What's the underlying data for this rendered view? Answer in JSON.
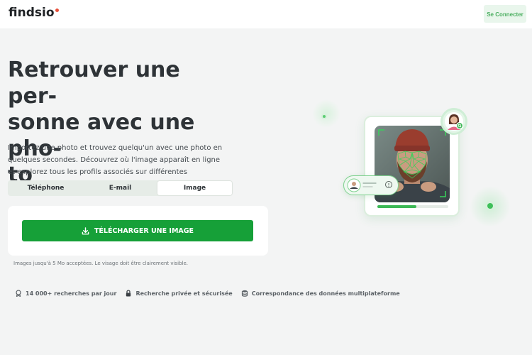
{
  "header": {
    "logo_text": "findsio",
    "login_label": "Se Connecter"
  },
  "hero": {
    "title": "Retrouver une per-\nsonne avec une pho-\nto",
    "description": "Importez une photo et trouvez quelqu'un avec une photo en quelques secondes. Découvrez où l'image apparaît en ligne et explorez tous les profils associés sur différentes plateformes."
  },
  "tabs": [
    {
      "label": "Téléphone",
      "active": false
    },
    {
      "label": "E-mail",
      "active": false
    },
    {
      "label": "Image",
      "active": true
    }
  ],
  "upload": {
    "button_label": "TÉLÉCHARGER UNE IMAGE",
    "note": "Images jusqu'à 5 Mo acceptées. Le visage doit être clairement visible."
  },
  "features": [
    {
      "icon": "award-icon",
      "text": "14 000+ recherches par jour"
    },
    {
      "icon": "lock-icon",
      "text": "Recherche privée et sécurisée"
    },
    {
      "icon": "database-icon",
      "text": "Correspondance des données multiplateforme"
    }
  ],
  "illustration": {
    "scan_progress": 0.55
  },
  "colors": {
    "brand_green": "#16a038",
    "logo_dot": "#e8503a",
    "background": "#f3f4f4"
  }
}
